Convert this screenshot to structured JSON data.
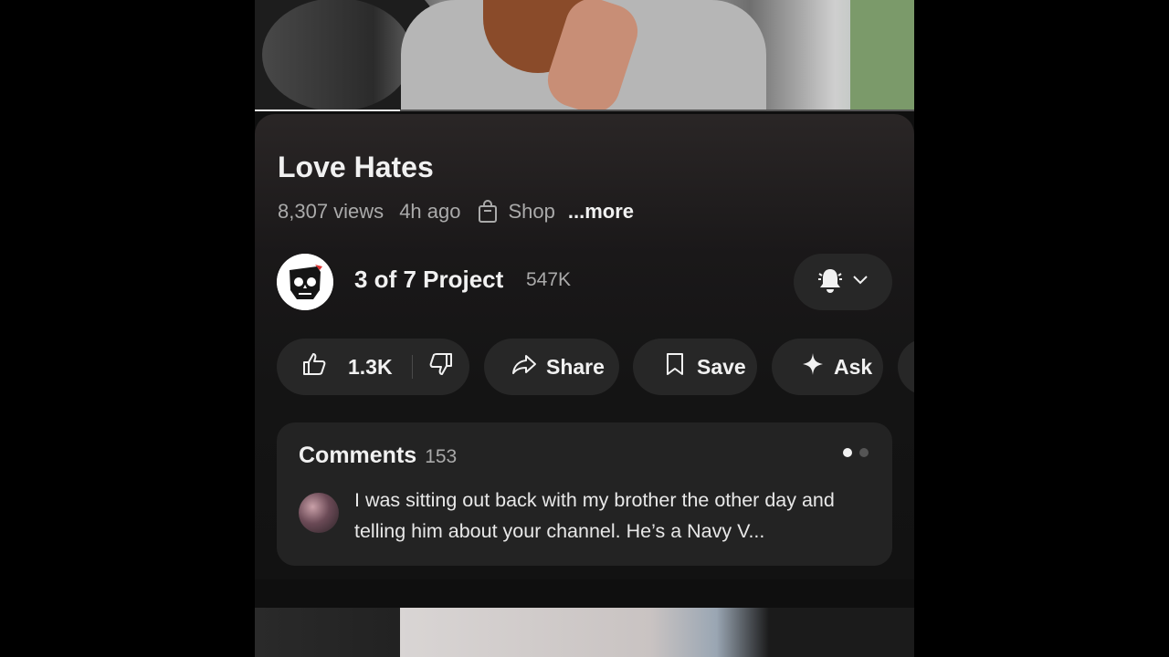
{
  "video": {
    "progress": 0.22
  },
  "title": "Love Hates",
  "meta": {
    "views": "8,307 views",
    "age": "4h ago",
    "shop": "Shop",
    "more": "...more"
  },
  "channel": {
    "name": "3 of 7 Project",
    "subscribers": "547K"
  },
  "actions": {
    "likes": "1.3K",
    "share": "Share",
    "save": "Save",
    "ask": "Ask"
  },
  "comments": {
    "label": "Comments",
    "count": "153",
    "top_comment": "I was sitting out back with my brother the other day and telling him about your channel. He’s a Navy V..."
  },
  "icons": [
    "shopping-bag-icon",
    "bell-icon",
    "chevron-down-icon",
    "thumbs-up-icon",
    "thumbs-down-icon",
    "share-icon",
    "bookmark-icon",
    "sparkle-icon"
  ]
}
